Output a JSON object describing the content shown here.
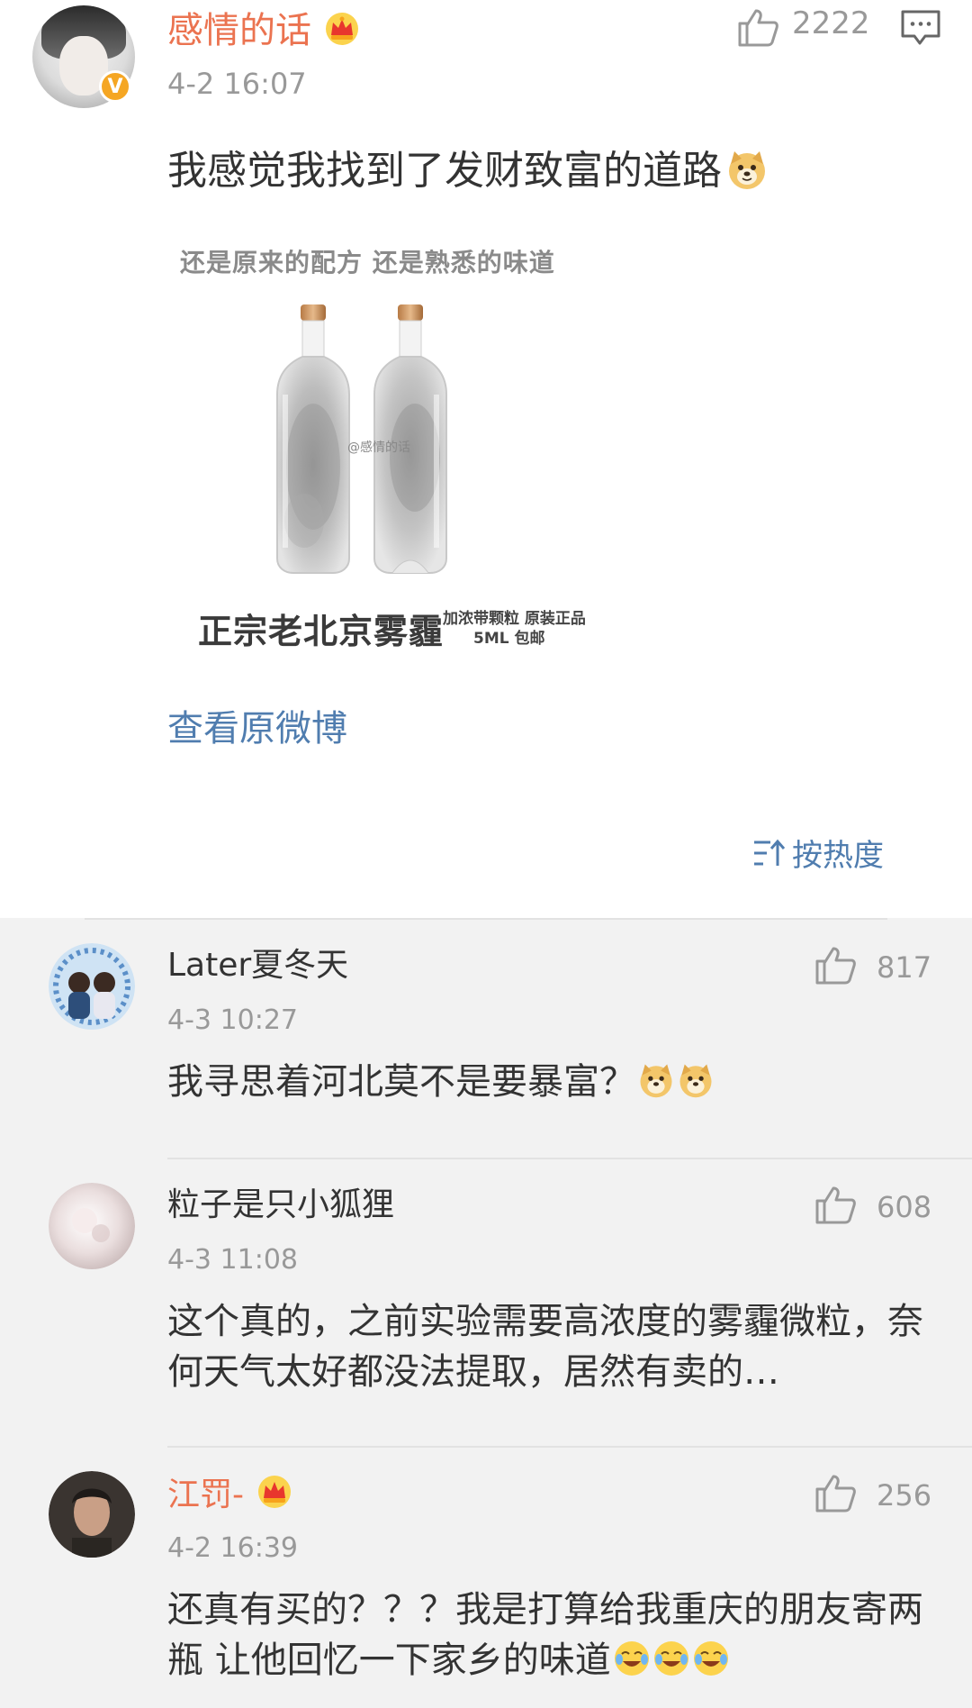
{
  "post": {
    "username": "感情的话",
    "time": "4-2 16:07",
    "like_count": "2222",
    "text": "我感觉我找到了发财致富的道路",
    "text_emoji": "doge-emoji",
    "image": {
      "top_caption": "还是原来的配方  还是熟悉的味道",
      "watermark": "@感情的话",
      "main_caption": "正宗老北京雾霾",
      "sub_caption_1": "加浓带颗粒 原装正品",
      "sub_caption_2": "5ML 包邮"
    },
    "view_original": "查看原微博",
    "sort_label": "按热度"
  },
  "comments": [
    {
      "username": "Later夏冬天",
      "vip": false,
      "time": "4-3 10:27",
      "like_count": "817",
      "text": "我寻思着河北莫不是要暴富？",
      "emojis": [
        "doge-emoji",
        "doge-emoji"
      ]
    },
    {
      "username": "粒子是只小狐狸",
      "vip": false,
      "time": "4-3 11:08",
      "like_count": "608",
      "text": "这个真的，之前实验需要高浓度的雾霾微粒，奈何天气太好都没法提取，居然有卖的…",
      "emojis": []
    },
    {
      "username": "江罚-",
      "vip": true,
      "time": "4-2 16:39",
      "like_count": "256",
      "text": "还真有买的？？？我是打算给我重庆的朋友寄两瓶 让他回忆一下家乡的味道",
      "emojis": [
        "laugh-cry-emoji",
        "laugh-cry-emoji",
        "laugh-cry-emoji"
      ]
    }
  ],
  "colors": {
    "vip_name": "#eb7350",
    "link": "#507daf",
    "meta": "#999999",
    "comments_bg": "#f2f2f2",
    "badge": "#f5a623"
  }
}
